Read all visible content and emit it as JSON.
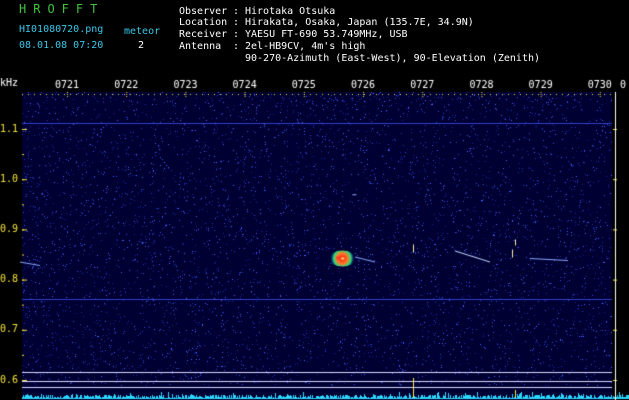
{
  "header": {
    "brand": "HROFFT",
    "filename": "HI01080720.png",
    "datetime": "08.01.08 07:20",
    "meteor_label": "meteor",
    "meteor_count": "2",
    "info": {
      "observer_label": "Observer",
      "observer": "Hirotaka Otsuka",
      "location_label": "Location",
      "location": "Hirakata, Osaka, Japan (135.7E, 34.9N)",
      "receiver_label": "Receiver",
      "receiver": "YAESU FT-690 53.749MHz, USB",
      "antenna_label": "Antenna",
      "antenna_line1": "2el-HB9CV, 4m's high",
      "antenna_line2": "90-270-Azimuth (East-West), 90-Elevation (Zenith)"
    }
  },
  "spectrogram": {
    "unit": "kHz",
    "freq_range_khz": [
      0.6,
      1.13
    ],
    "time_ticks": [
      "0721",
      "0722",
      "0723",
      "0724",
      "0725",
      "0726",
      "0727",
      "0728",
      "0729",
      "0730"
    ],
    "end_tick": "0",
    "freq_ticks": [
      "1.1",
      "1.0",
      "0.9",
      "0.8",
      "0.7",
      "0.6"
    ],
    "freq_tick_values": [
      1.1,
      1.0,
      0.9,
      0.8,
      0.7,
      0.6
    ],
    "colors": {
      "background": "#000033",
      "axis_text": "#f2e23a",
      "tick_text": "#ffffff",
      "noise": "#2a3cc0",
      "meteor_core": "#ff2a1a",
      "meteor_mid": "#22e07a",
      "trace": "#c8d6ff",
      "baseline": "#2ad8ff"
    }
  }
}
